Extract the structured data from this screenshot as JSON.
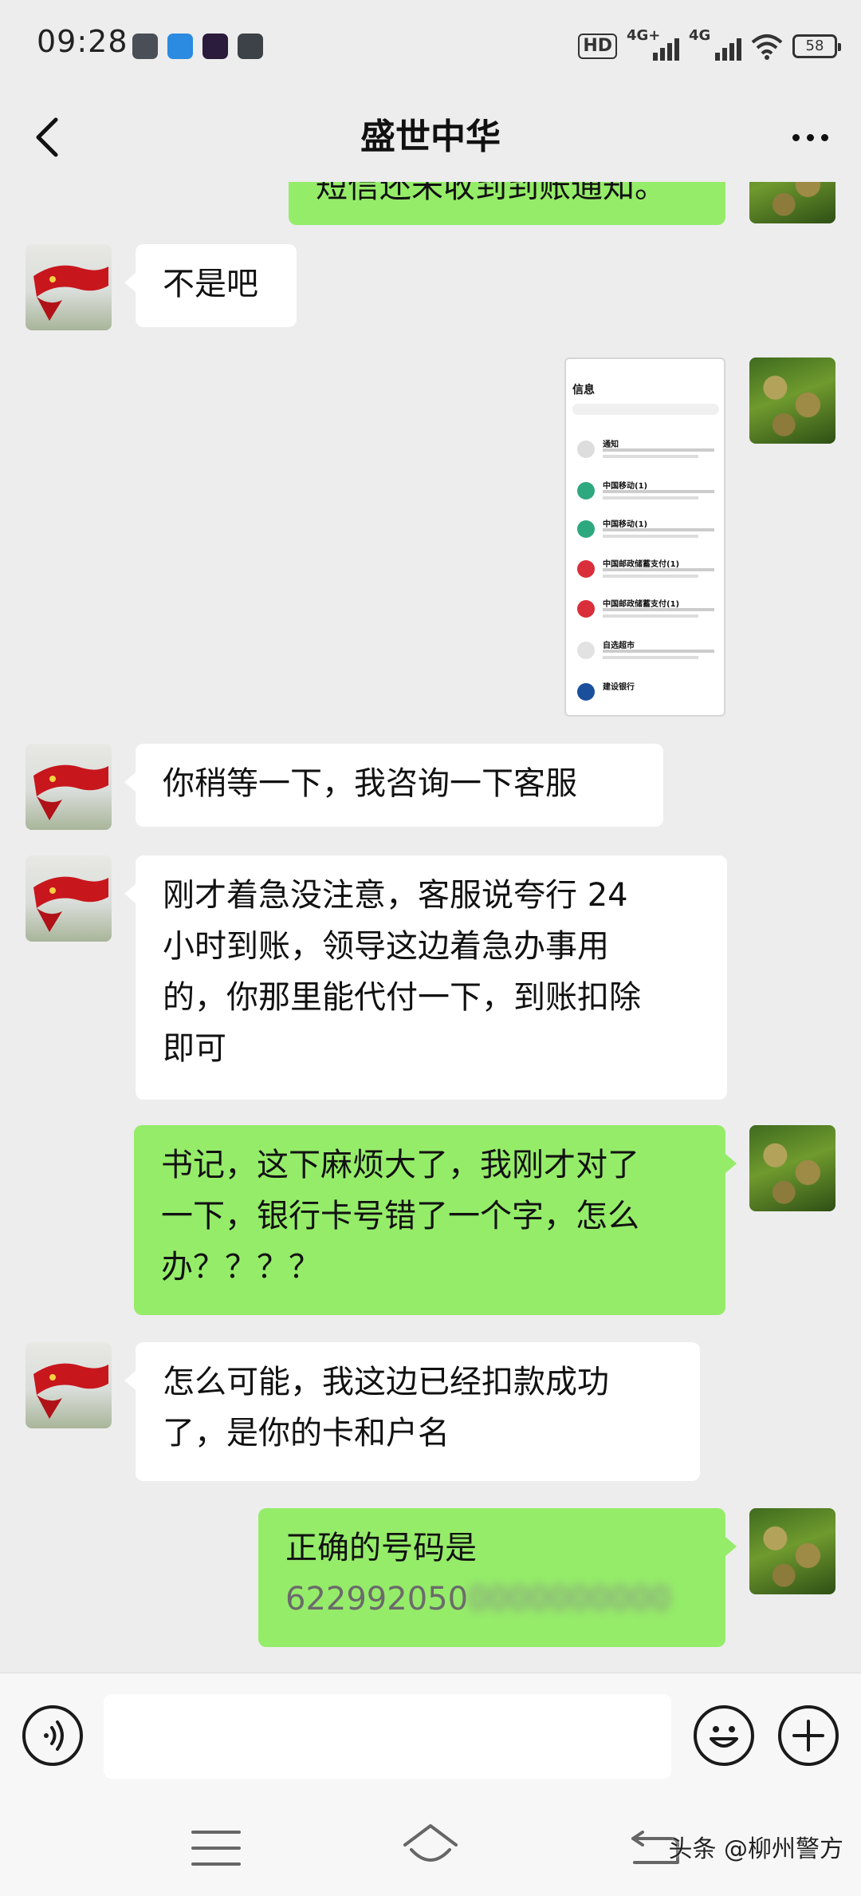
{
  "status_bar": {
    "time": "09:28",
    "hd_label": "HD",
    "signal1_label": "4G+",
    "signal2_label": "4G",
    "battery": "58"
  },
  "header": {
    "title": "盛世中华"
  },
  "messages": [
    {
      "side": "out",
      "text": "短信还未收到到账通知。"
    },
    {
      "side": "in",
      "text": "不是吧"
    },
    {
      "side": "out",
      "type": "image",
      "text": "信息"
    },
    {
      "side": "in",
      "text": "你稍等一下，我咨询一下客服"
    },
    {
      "side": "in",
      "lines": [
        "刚才着急没注意，客服说夸行 24",
        "小时到账，领导这边着急办事用",
        "的，你那里能代付一下，到账扣除",
        "即可"
      ]
    },
    {
      "side": "out",
      "lines": [
        "书记，这下麻烦大了，我刚才对了",
        "一下，银行卡号错了一个字，怎么",
        "办？？？？"
      ]
    },
    {
      "side": "in",
      "lines": [
        "怎么可能，我这边已经扣款成功",
        "了，是你的卡和户名"
      ]
    },
    {
      "side": "out",
      "line1": "正确的号码是",
      "number_visible": "622992050",
      "number_blurred": "0000000000"
    }
  ],
  "screenshot_preview": {
    "title": "信息",
    "rows": [
      "通知",
      "中国移动(1)",
      "中国移动(1)",
      "中国邮政储蓄支付(1)",
      "中国邮政储蓄支付(1)",
      "自选超市",
      "建设银行"
    ]
  },
  "watermark": "头条 @柳州警方",
  "colors": {
    "outgoing_bubble": "#95ec69",
    "incoming_bubble": "#ffffff",
    "background": "#ededed"
  },
  "icons": [
    "back-icon",
    "more-icon",
    "voice-icon",
    "emoji-icon",
    "plus-icon",
    "menu-icon",
    "home-icon",
    "return-icon"
  ]
}
